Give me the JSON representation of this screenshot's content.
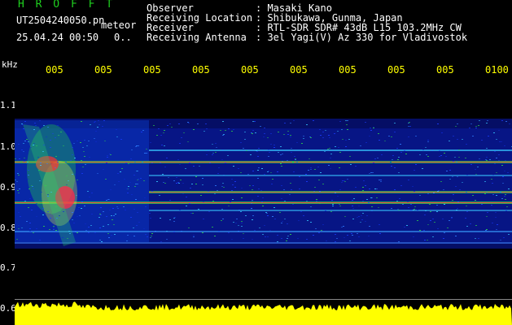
{
  "header": {
    "title": "H R O F F T",
    "file_name": "UT2504240050.pn",
    "file_tag": "meteor",
    "datetime": "25.04.24 00:50",
    "dots": "0.."
  },
  "station": {
    "rows": [
      {
        "label": "Observer",
        "value": ": Masaki Kano"
      },
      {
        "label": "Receiving Location",
        "value": ": Shibukawa, Gunma, Japan"
      },
      {
        "label": "Receiver",
        "value": ": RTL-SDR SDR# 43dB L15 103.2MHz CW"
      },
      {
        "label": "Receiving Antenna",
        "value": ": 3el Yagi(V) Az 330 for Vladivostok"
      }
    ]
  },
  "y_axis": {
    "unit": "kHz",
    "labels": [
      "1.1",
      "1.0",
      "0.9",
      "0.8",
      "0.7",
      "0.6"
    ]
  },
  "x_axis": {
    "labels": [
      "005",
      "005",
      "005",
      "005",
      "005",
      "005",
      "005",
      "005",
      "005",
      "0100"
    ]
  },
  "colors": {
    "title": "#1fd11f",
    "axis_tick": "#ffff00",
    "text": "#ffffff",
    "background": "#000000",
    "power": "#ffff00"
  }
}
